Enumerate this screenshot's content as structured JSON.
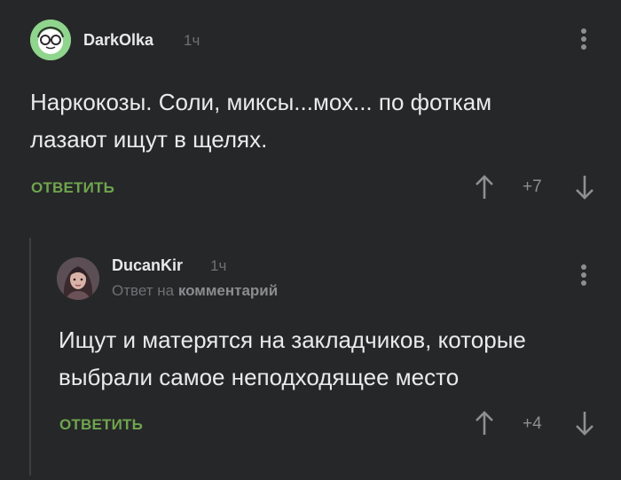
{
  "comments": [
    {
      "author": "DarkOlka",
      "time": "1ч",
      "text_lines": [
        "Наркокозы. Соли, миксы...мох... по фоткам",
        "лазают ищут в щелях."
      ],
      "reply_label": "ОТВЕТИТЬ",
      "score": "+7",
      "avatar_icon": "glasses-face-icon"
    },
    {
      "author": "DucanKir",
      "time": "1ч",
      "reply_prefix": "Ответ на",
      "reply_target": "комментарий",
      "text_lines": [
        "Ищут и матерятся на закладчиков, которые",
        "выбрали самое неподходящее место"
      ],
      "reply_label": "ОТВЕТИТЬ",
      "score": "+4",
      "avatar_icon": "user-photo-avatar"
    }
  ],
  "colors": {
    "background": "#262729",
    "accent_green": "#6fa54d",
    "muted_text": "#6e7072"
  }
}
